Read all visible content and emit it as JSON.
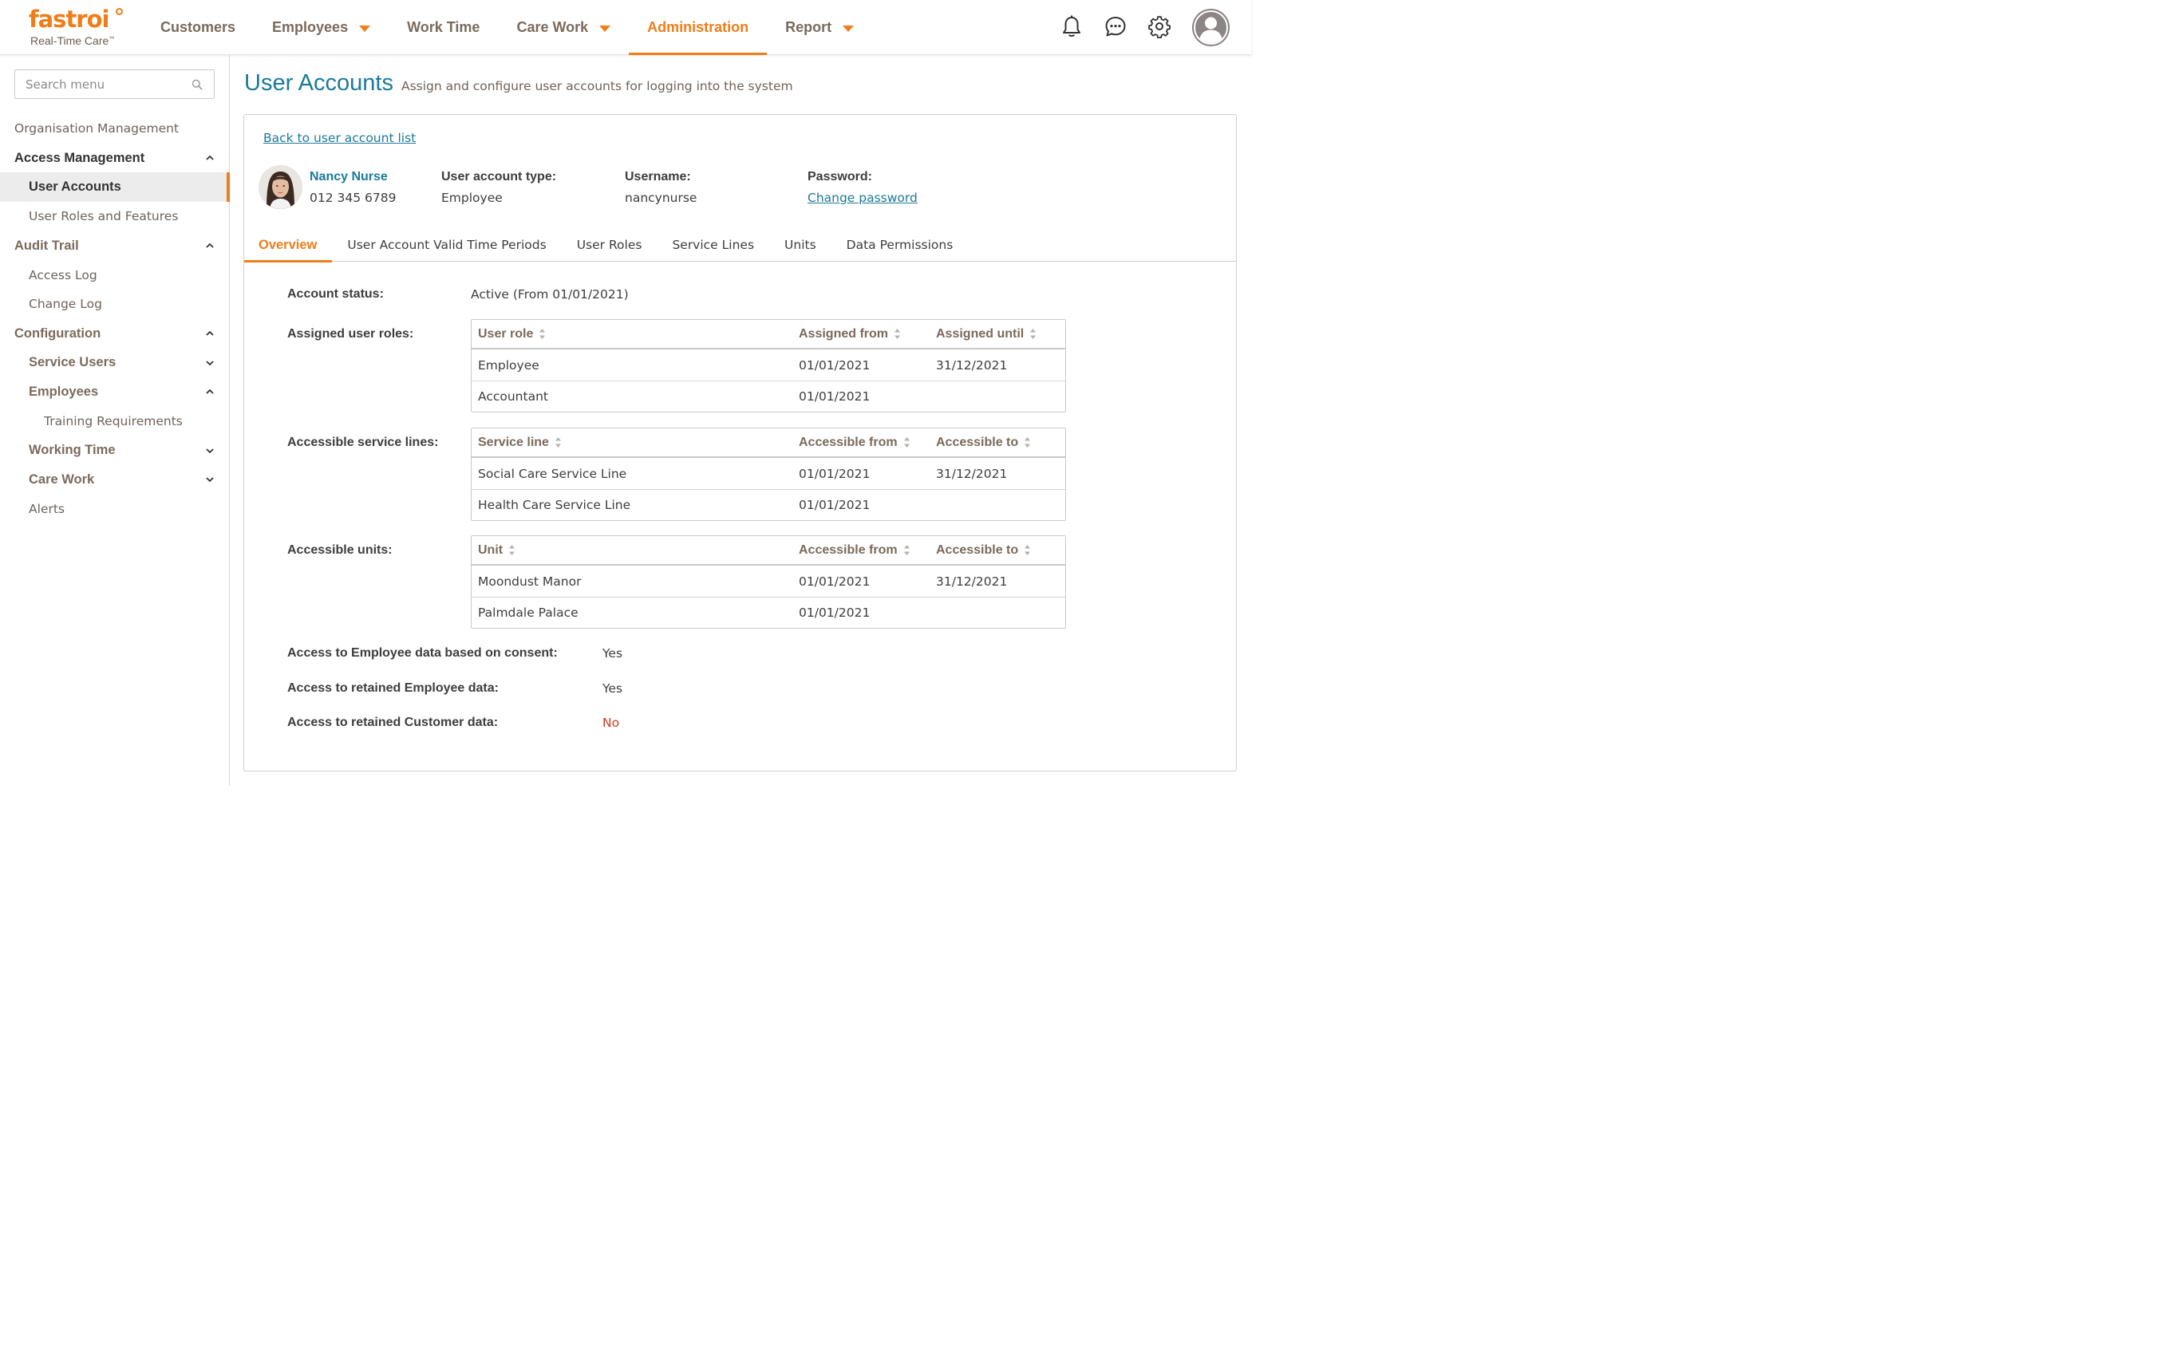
{
  "header": {
    "logo_text": "fastroi",
    "logo_sub": "Real-Time Care",
    "logo_tm": "™",
    "nav": [
      {
        "label": "Customers",
        "dropdown": false,
        "active": false
      },
      {
        "label": "Employees",
        "dropdown": true,
        "active": false
      },
      {
        "label": "Work Time",
        "dropdown": false,
        "active": false
      },
      {
        "label": "Care Work",
        "dropdown": true,
        "active": false
      },
      {
        "label": "Administration",
        "dropdown": false,
        "active": true
      },
      {
        "label": "Report",
        "dropdown": true,
        "active": false
      }
    ],
    "icons": [
      "bell-icon",
      "chat-icon",
      "gear-icon",
      "user-avatar-icon"
    ]
  },
  "sidebar": {
    "search_placeholder": "Search menu",
    "items": [
      {
        "label": "Organisation Management"
      },
      {
        "label": "Access Management"
      },
      {
        "label": "User Accounts"
      },
      {
        "label": "User Roles and Features"
      },
      {
        "label": "Audit Trail"
      },
      {
        "label": "Access Log"
      },
      {
        "label": "Change Log"
      },
      {
        "label": "Configuration"
      },
      {
        "label": "Service Users"
      },
      {
        "label": "Employees"
      },
      {
        "label": "Training Requirements"
      },
      {
        "label": "Working Time"
      },
      {
        "label": "Care Work"
      },
      {
        "label": "Alerts"
      }
    ]
  },
  "page": {
    "title": "User Accounts",
    "subtitle": "Assign and configure user accounts for logging into the system",
    "back_link": "Back to user account list"
  },
  "person": {
    "name": "Nancy Nurse",
    "phone": "012 345 6789",
    "account_type_label": "User account type:",
    "account_type": "Employee",
    "username_label": "Username:",
    "username": "nancynurse",
    "password_label": "Password:",
    "password_link": "Change password"
  },
  "tabs": [
    {
      "label": "Overview"
    },
    {
      "label": "User Account Valid Time Periods"
    },
    {
      "label": "User Roles"
    },
    {
      "label": "Service Lines"
    },
    {
      "label": "Units"
    },
    {
      "label": "Data Permissions"
    }
  ],
  "overview": {
    "status_label": "Account status:",
    "status_value": "Active (From 01/01/2021)",
    "roles": {
      "label": "Assigned user roles:",
      "headers": [
        "User role",
        "Assigned from",
        "Assigned until"
      ],
      "rows": [
        [
          "Employee",
          "01/01/2021",
          "31/12/2021"
        ],
        [
          "Accountant",
          "01/01/2021",
          ""
        ]
      ]
    },
    "service_lines": {
      "label": "Accessible service lines:",
      "headers": [
        "Service line",
        "Accessible from",
        "Accessible to"
      ],
      "rows": [
        [
          "Social Care Service Line",
          "01/01/2021",
          "31/12/2021"
        ],
        [
          "Health Care Service Line",
          "01/01/2021",
          ""
        ]
      ]
    },
    "units": {
      "label": "Accessible units:",
      "headers": [
        "Unit",
        "Accessible from",
        "Accessible to"
      ],
      "rows": [
        [
          "Moondust Manor",
          "01/01/2021",
          "31/12/2021"
        ],
        [
          "Palmdale Palace",
          "01/01/2021",
          ""
        ]
      ]
    },
    "consent_label": "Access to Employee data based on consent:",
    "consent_value": "Yes",
    "retained_employee_label": "Access to retained Employee data:",
    "retained_employee_value": "Yes",
    "retained_customer_label": "Access to retained Customer data:",
    "retained_customer_value": "No"
  },
  "colors": {
    "accent": "#ef7d1a",
    "link": "#1b7a9a",
    "negative": "#d03a1a"
  }
}
